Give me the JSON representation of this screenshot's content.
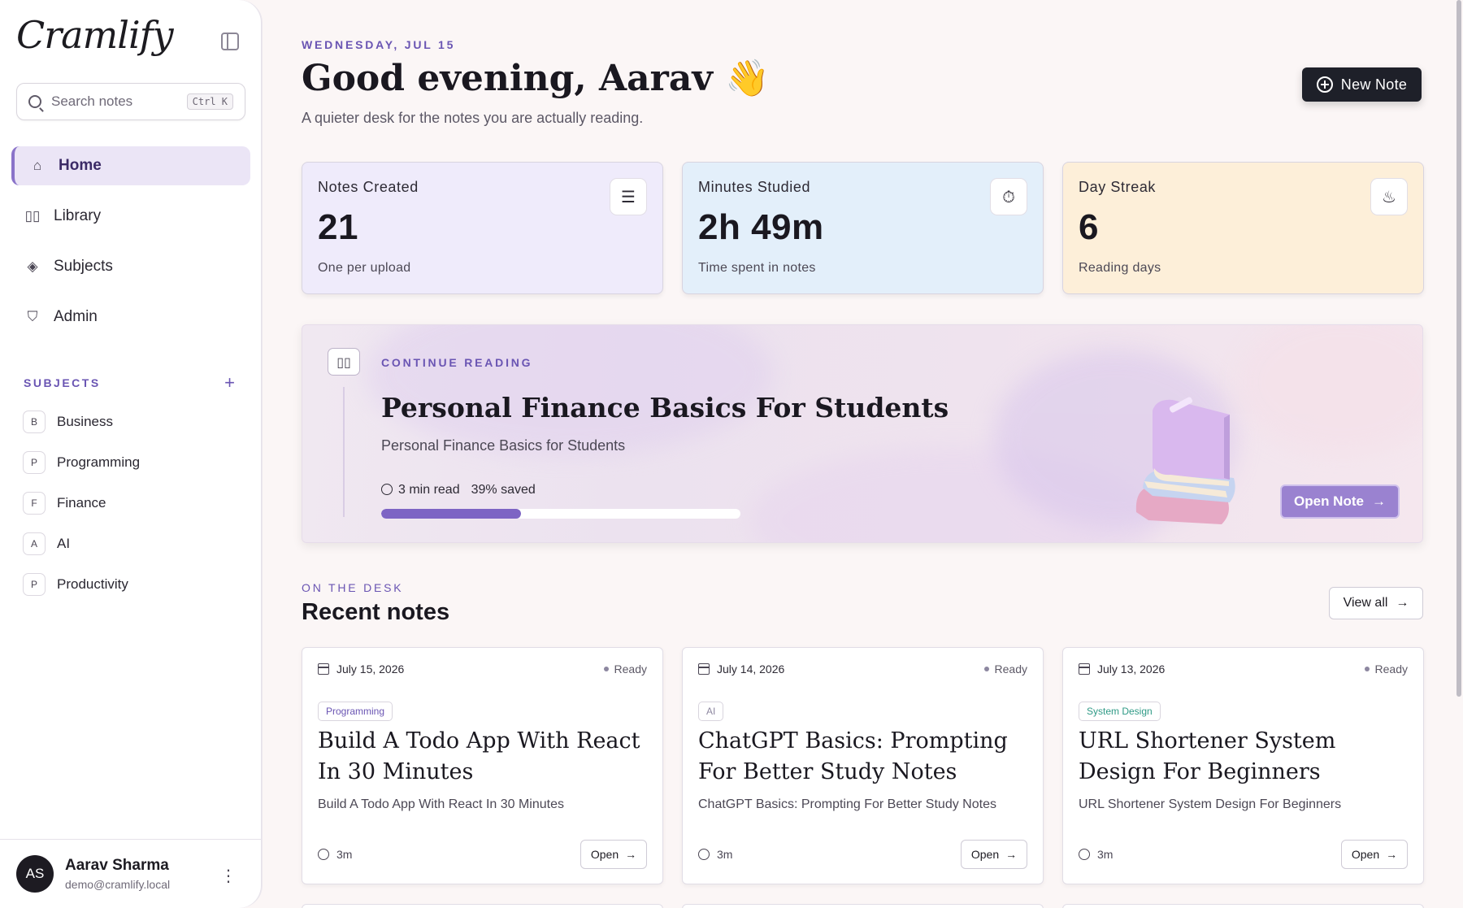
{
  "app": {
    "logo": "Cramlify"
  },
  "search": {
    "placeholder": "Search notes",
    "shortcut": "Ctrl K"
  },
  "nav": [
    {
      "label": "Home",
      "icon": "home-icon",
      "active": true
    },
    {
      "label": "Library",
      "icon": "book-icon",
      "active": false
    },
    {
      "label": "Subjects",
      "icon": "layers-icon",
      "active": false
    },
    {
      "label": "Admin",
      "icon": "shield-icon",
      "active": false
    }
  ],
  "subjects": {
    "heading": "SUBJECTS",
    "items": [
      {
        "initial": "B",
        "label": "Business"
      },
      {
        "initial": "P",
        "label": "Programming"
      },
      {
        "initial": "F",
        "label": "Finance"
      },
      {
        "initial": "A",
        "label": "AI"
      },
      {
        "initial": "P",
        "label": "Productivity"
      }
    ]
  },
  "user": {
    "initials": "AS",
    "name": "Aarav Sharma",
    "email": "demo@cramlify.local"
  },
  "header": {
    "date": "WEDNESDAY, JUL 15",
    "greeting": "Good evening, Aarav",
    "wave": "👋",
    "subtitle": "A quieter desk for the notes you are actually reading.",
    "new_note_label": "New Note"
  },
  "stats": [
    {
      "label": "Notes Created",
      "value": "21",
      "note": "One per upload",
      "bg": "#efebfb",
      "icon": "notes-icon"
    },
    {
      "label": "Minutes Studied",
      "value": "2h 49m",
      "note": "Time spent in notes",
      "bg": "#e3effa",
      "icon": "timer-icon"
    },
    {
      "label": "Day Streak",
      "value": "6",
      "note": "Reading days",
      "bg": "#fdefd9",
      "icon": "flame-icon"
    }
  ],
  "continue_reading": {
    "label": "CONTINUE READING",
    "title": "Personal Finance Basics For Students",
    "subtitle": "Personal Finance Basics for Students",
    "read_time": "3 min read",
    "saved": "39% saved",
    "progress": 0.39,
    "button": "Open Note"
  },
  "desk": {
    "label": "ON THE DESK",
    "title": "Recent notes",
    "view_all": "View all",
    "notes": [
      {
        "date": "July 15, 2026",
        "status": "Ready",
        "tag": "Programming",
        "tag_color": "#6a55b3",
        "title": "Build A Todo App With React In 30 Minutes",
        "desc": "Build A Todo App With React In 30 Minutes",
        "time": "3m",
        "open": "Open"
      },
      {
        "date": "July 14, 2026",
        "status": "Ready",
        "tag": "AI",
        "tag_color": "#8d87a0",
        "title": "ChatGPT Basics: Prompting For Better Study Notes",
        "desc": "ChatGPT Basics: Prompting For Better Study Notes",
        "time": "3m",
        "open": "Open"
      },
      {
        "date": "July 13, 2026",
        "status": "Ready",
        "tag": "System Design",
        "tag_color": "#2f9a86",
        "title": "URL Shortener System Design For Beginners",
        "desc": "URL Shortener System Design For Beginners",
        "time": "3m",
        "open": "Open"
      }
    ]
  }
}
